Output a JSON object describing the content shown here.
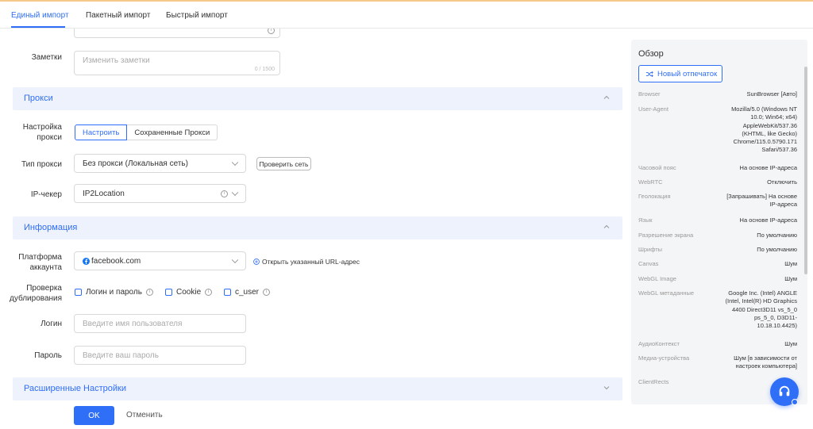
{
  "tabs": [
    {
      "label": "Единый импорт",
      "active": true
    },
    {
      "label": "Пакетный импорт",
      "active": false
    },
    {
      "label": "Быстрый импорт",
      "active": false
    }
  ],
  "notes": {
    "label": "Заметки",
    "placeholder": "Изменить заметки",
    "counter": "0 / 1500"
  },
  "proxy": {
    "section_title": "Прокси",
    "setup_label": "Настройка прокси",
    "setup_options": [
      "Настроить",
      "Сохраненные Прокси"
    ],
    "type_label": "Тип прокси",
    "type_value": "Без прокси (Локальная сеть)",
    "check_button": "Проверить сеть",
    "ipchecker_label": "IP-чекер",
    "ipchecker_value": "IP2Location"
  },
  "info": {
    "section_title": "Информация",
    "platform_label": "Платформа аккаунта",
    "platform_value": "facebook.com",
    "open_url_link": "Открыть указанный URL-адрес",
    "dup_label": "Проверка дублирования",
    "dup_options": [
      "Логин и пароль",
      "Cookie",
      "c_user"
    ],
    "login_label": "Логин",
    "login_placeholder": "Введите имя пользователя",
    "password_label": "Пароль",
    "password_placeholder": "Введите ваш пароль"
  },
  "advanced": {
    "section_title": "Расширенные Настройки"
  },
  "footer": {
    "ok": "OK",
    "cancel": "Отменить"
  },
  "overview": {
    "title": "Обзор",
    "new_fingerprint": "Новый отпечаток",
    "rows": [
      {
        "key": "Browser",
        "value": "SunBrowser [Авто]"
      },
      {
        "key": "User-Agent",
        "value": "Mozilla/5.0 (Windows NT 10.0; Win64; x64) AppleWebKit/537.36 (KHTML, like Gecko) Chrome/115.0.5790.171 Safari/537.36"
      },
      {
        "key": "Часовой пояс",
        "value": "На основе IP-адреса"
      },
      {
        "key": "WebRTC",
        "value": "Отключить"
      },
      {
        "key": "Геолокация",
        "value": "[Запрашивать] На основе IP-адреса"
      },
      {
        "key": "Язык",
        "value": "На основе IP-адреса"
      },
      {
        "key": "Разрешение экрана",
        "value": "По умолчанию"
      },
      {
        "key": "Шрифты",
        "value": "По умолчанию"
      },
      {
        "key": "Canvas",
        "value": "Шум"
      },
      {
        "key": "WebGL Image",
        "value": "Шум"
      },
      {
        "key": "WebGL метаданные",
        "value": "Google Inc. (Intel) ANGLE (Intel, Intel(R) HD Graphics 4400 Direct3D11 vs_5_0 ps_5_0, D3D11-10.18.10.4425)"
      },
      {
        "key": "АудиоКонтекст",
        "value": "Шум"
      },
      {
        "key": "Медиа-устройства",
        "value": "Шум [в зависимости от настроек компьютера]"
      },
      {
        "key": "ClientRects",
        "value": ""
      }
    ]
  },
  "colors": {
    "accent": "#2f6ef7",
    "section_bg": "#eef2fd",
    "side_bg": "#f4f5f7"
  }
}
